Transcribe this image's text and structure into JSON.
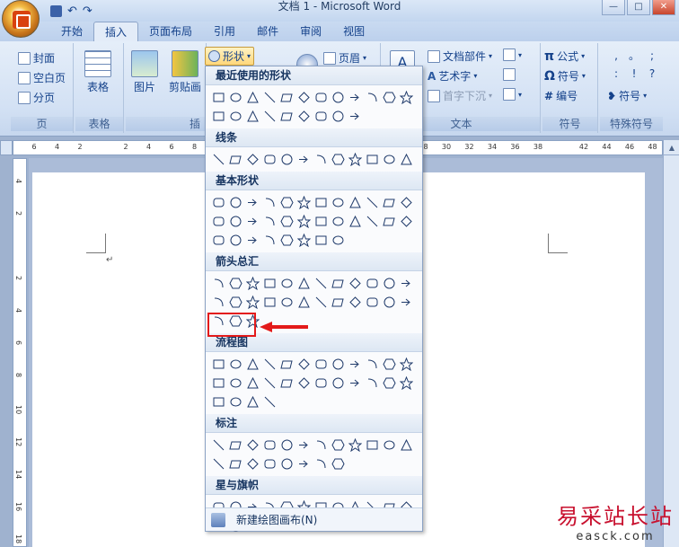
{
  "window": {
    "title": "文档 1 - Microsoft Word",
    "controls": {
      "minimize": "—",
      "maximize": "□",
      "close": "✕"
    }
  },
  "quick_access": {
    "save_icon": "save-icon",
    "undo_icon": "undo-icon",
    "redo_icon": "redo-icon"
  },
  "tabs": [
    {
      "label": "开始"
    },
    {
      "label": "插入",
      "active": true
    },
    {
      "label": "页面布局"
    },
    {
      "label": "引用"
    },
    {
      "label": "邮件"
    },
    {
      "label": "审阅"
    },
    {
      "label": "视图"
    }
  ],
  "ribbon": {
    "page_group": {
      "items": [
        "封面",
        "空白页",
        "分页"
      ],
      "label": "页"
    },
    "table_group": {
      "button": "表格",
      "label": "表格"
    },
    "illustrations_group": {
      "picture": "图片",
      "clipart": "剪贴画",
      "shapes": "形状",
      "label": "插"
    },
    "header_group": {
      "header": "页眉"
    },
    "text_group": {
      "docparts": "文档部件",
      "wordart": "艺术字",
      "dropcap": "首字下沉",
      "label": "文本"
    },
    "symbol_group": {
      "formula": "公式",
      "symbol": "符号",
      "number": "编号",
      "label": "符号"
    },
    "special_group": {
      "symbols": "符号",
      "label": "特殊符号",
      "chars": [
        ",",
        "。",
        ";",
        ":",
        "!",
        "?"
      ]
    }
  },
  "ruler": {
    "ticks": [
      "6",
      "4",
      "2",
      "",
      "2",
      "4",
      "6",
      "8",
      "10",
      "12",
      "14",
      "16",
      "18",
      "20",
      "22",
      "24",
      "26",
      "28",
      "30",
      "32",
      "34",
      "36",
      "38",
      "",
      "42",
      "44",
      "46",
      "48"
    ],
    "vticks": [
      "4",
      "2",
      "",
      "2",
      "4",
      "6",
      "8",
      "10",
      "12",
      "14",
      "16",
      "18"
    ]
  },
  "document": {
    "para_mark": "↵"
  },
  "dropdown": {
    "sections": [
      {
        "title": "最近使用的形状",
        "count": 21
      },
      {
        "title": "线条",
        "count": 12
      },
      {
        "title": "基本形状",
        "count": 32
      },
      {
        "title": "箭头总汇",
        "count": 27
      },
      {
        "title": "流程图",
        "count": 28
      },
      {
        "title": "标注",
        "count": 20
      },
      {
        "title": "星与旗帜",
        "count": 16
      }
    ],
    "footer": "新建绘图画布(N)"
  },
  "annotation": {
    "highlight_color": "#e31a1a"
  },
  "watermark": {
    "text": "易采站长站",
    "url": "easck.com"
  }
}
